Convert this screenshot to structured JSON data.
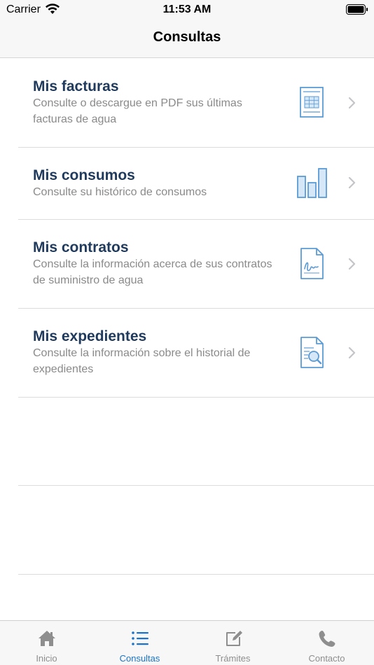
{
  "status_bar": {
    "carrier": "Carrier",
    "time": "11:53 AM",
    "wifi_icon": "wifi-icon",
    "battery_icon": "battery-icon"
  },
  "nav": {
    "title": "Consultas"
  },
  "rows": [
    {
      "title": "Mis facturas",
      "description": "Consulte o descargue en PDF sus últimas facturas de agua",
      "icon": "invoice-icon"
    },
    {
      "title": "Mis consumos",
      "description": "Consulte su histórico de consumos",
      "icon": "bar-chart-icon"
    },
    {
      "title": "Mis contratos",
      "description": "Consulte la información acerca de sus contratos de suministro de agua",
      "icon": "signed-contract-icon"
    },
    {
      "title": "Mis expedientes",
      "description": "Consulte la información sobre el historial de expedientes",
      "icon": "document-search-icon"
    }
  ],
  "tabs": [
    {
      "label": "Inicio",
      "icon": "home-icon",
      "active": false
    },
    {
      "label": "Consultas",
      "icon": "list-icon",
      "active": true
    },
    {
      "label": "Trámites",
      "icon": "edit-icon",
      "active": false
    },
    {
      "label": "Contacto",
      "icon": "phone-icon",
      "active": false
    }
  ],
  "colors": {
    "accent": "#1a73c9",
    "row_title": "#1f3a5c",
    "icon_blue": "#5b9bd5",
    "inactive_tab": "#8e8e8e"
  }
}
